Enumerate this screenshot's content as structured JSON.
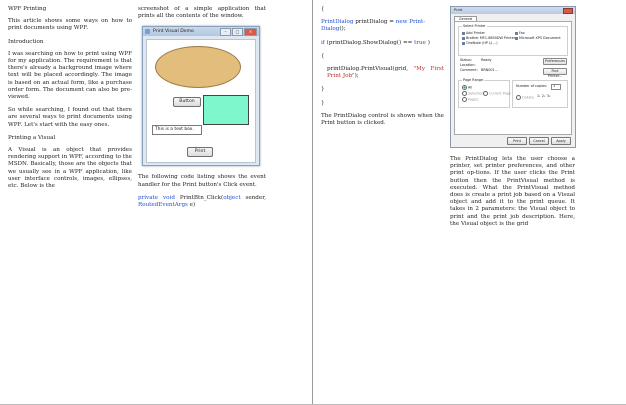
{
  "left_page": {
    "col1": {
      "title": "WPF Printing",
      "intro": "This article shows some ways on how to print documents using WPF.",
      "h_intro": "Introduction",
      "p1": "I was searching on how to print using WPF for my application. The requirement is that there's already a background image where text will be placed accordingly. The image is based on an actual form, like a purchase order form. The document can also be pre-viewed.",
      "p2": "So while searching, I found out that there are several ways to print documents using WPF. Let's start with the easy ones.",
      "h_visual": "Printing a Visual",
      "p3": "A Visual is an object that provides rendering support in WPF, according to the MSDN. Basically, those are the objects that we usually see in a WPF application, like user interface controls, images, ellipses, etc. Below is the"
    },
    "col2": {
      "p_top": "screenshot of a simple application that prints all the contents of the window.",
      "window": {
        "title": "Print Visual Demo",
        "button_label": "Button",
        "textbox_value": "This is a text box.",
        "print_label": "Print",
        "ellipse_color": "#e3bd7c",
        "rect_color": "#7ff7cc"
      },
      "p_listing": "The following code listing shows the  event handler for the Print button's Click event.",
      "code_kw1": "private",
      "code_kw2": "void",
      "code_t1": "PrintBtn_Click(",
      "code_kw3": "object",
      "code_t2": "sender,",
      "code_t3": "RoutedEventArgs",
      "code_t4": "e)"
    }
  },
  "right_page": {
    "col1": {
      "brace_open": "{",
      "l1_t1": "PrintDialog",
      "l1_t2": "printDialog",
      "l1_t3": "=",
      "l1_kw": "new",
      "l1_t4": "Print-",
      "l1_t5": "Dialog",
      "l1_t6": "();",
      "l2_t1": "if",
      "l2_t2": "(printDialog.ShowDialog()",
      "l2_t3": "==",
      "l2_kw": "true",
      "l2_t4": ")",
      "brace2": "{",
      "l3_t1": "printDialog.PrintVisual(grid,",
      "l3_str": "\"My First Print Job\"",
      "l3_t2": ");",
      "brace3": "}",
      "brace4": "}",
      "p1": "The PrintDialog control is shown when the Print button is clicked."
    },
    "col2": {
      "dialog": {
        "title": "Print",
        "tab": "General",
        "grp_printer": "Select Printer",
        "printers": [
          "Add Printer",
          "Brother MFC-8890DW Printer",
          "OneNote (HP LJ ...)",
          "Fax",
          "Microsoft XPS Document"
        ],
        "status_label": "Status:",
        "status_value": "Ready",
        "location_label": "Location:",
        "comment_label": "Comment:",
        "comment_value": "BRN001...",
        "preferences": "Preferences",
        "find_printer": "Find Printer...",
        "grp_range": "Page Range",
        "range_all": "All",
        "range_selection": "Selection",
        "range_current": "Current Page",
        "range_pages": "Pages:",
        "copies_label": "Number of copies:",
        "copies_value": "1",
        "collate_label": "Collate",
        "collate_glyph": "1₁ 2₂ 3₃",
        "btn_print": "Print",
        "btn_cancel": "Cancel",
        "btn_apply": "Apply"
      },
      "p1": "The PrintDialog lets the user choose a printer, set printer preferences, and other print op-tions. If the user clicks the Print button then the PrintVisual method is executed. What the PrintVisual method does is create a print job based on a Visual object and add it to the print queue. It takes in 2 parameters: the Visual object to print and the print job description. Here, the Visual object is the grid"
    }
  }
}
